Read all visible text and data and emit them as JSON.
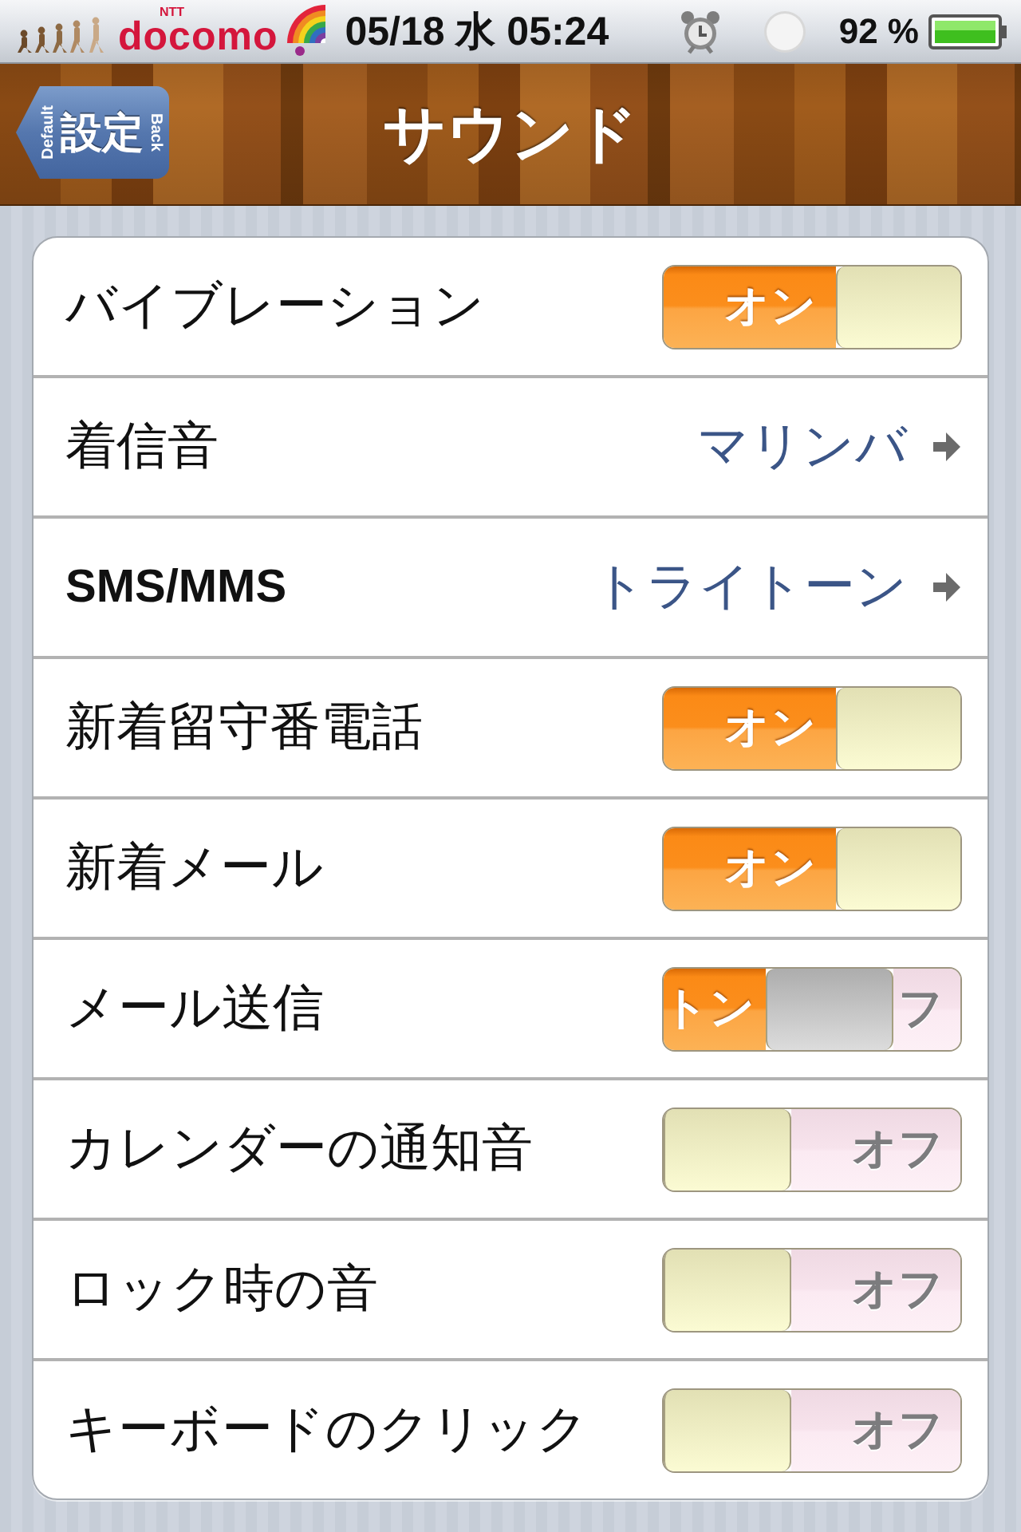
{
  "status_bar": {
    "carrier_brand": "NTT",
    "carrier": "docomo",
    "datetime": "05/18 水 05:24",
    "battery": "92 %"
  },
  "nav_bar": {
    "title": "サウンド",
    "back_button": {
      "label": "設定",
      "left_tag": "Default",
      "right_tag": "Back"
    }
  },
  "rows": [
    {
      "kind": "switch",
      "label": "バイブレーション",
      "on": true,
      "switch_label": "オン"
    },
    {
      "kind": "link",
      "label": "着信音",
      "value": "マリンバ"
    },
    {
      "kind": "link",
      "label": "SMS/MMS",
      "value": "トライトーン"
    },
    {
      "kind": "switch",
      "label": "新着留守番電話",
      "on": true,
      "switch_label": "オン"
    },
    {
      "kind": "switch",
      "label": "新着メール",
      "on": true,
      "switch_label": "オン"
    },
    {
      "kind": "switch_moving",
      "label": "メール送信",
      "level": 0.59,
      "on_label": "トン",
      "off_label": "フ"
    },
    {
      "kind": "switch",
      "label": "カレンダーの通知音",
      "on": false,
      "switch_label": "オフ"
    },
    {
      "kind": "switch",
      "label": "ロック時の音",
      "on": false,
      "switch_label": "オフ"
    },
    {
      "kind": "switch",
      "label": "キーボードのクリック",
      "on": false,
      "switch_label": "オフ"
    }
  ]
}
